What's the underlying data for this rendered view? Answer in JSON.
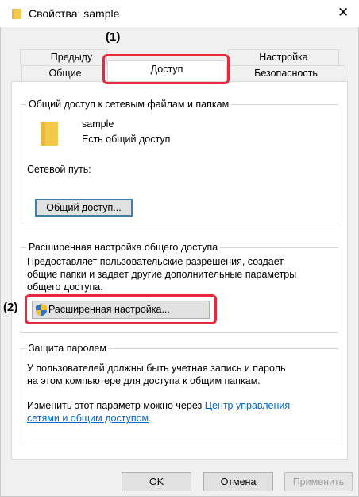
{
  "window": {
    "title": "Свойства: sample",
    "close_glyph": "✕"
  },
  "tabs": {
    "row1": [
      "Предыду",
      "Настройка"
    ],
    "row2": [
      "Общие",
      "Доступ",
      "Безопасность"
    ]
  },
  "callouts": {
    "c1": "(1)",
    "c2": "(2)"
  },
  "share": {
    "group_title": "Общий доступ к сетевым файлам и папкам",
    "folder_name": "sample",
    "status": "Есть общий доступ",
    "path_label": "Сетевой путь:",
    "share_button": "Общий доступ..."
  },
  "advanced": {
    "group_title": "Расширенная настройка общего доступа",
    "description_1": "Предоставляет пользовательские разрешения, создает",
    "description_2": "общие папки и задает другие дополнительные параметры",
    "description_3": "общего доступа.",
    "button": "Расширенная настройка..."
  },
  "password": {
    "group_title": "Защита паролем",
    "text_1": "У пользователей должны быть учетная запись и пароль",
    "text_2": "на этом компьютере для доступа к общим папкам.",
    "change_text": "Изменить этот параметр можно через",
    "link_1": "Центр управления",
    "link_2": "сетями и общим доступом",
    "link_end": "."
  },
  "buttons": {
    "ok": "OK",
    "cancel": "Отмена",
    "apply": "Применить"
  },
  "colors": {
    "highlight": "#e8283c",
    "link": "#0066cc",
    "folder": "#f4c84a"
  }
}
